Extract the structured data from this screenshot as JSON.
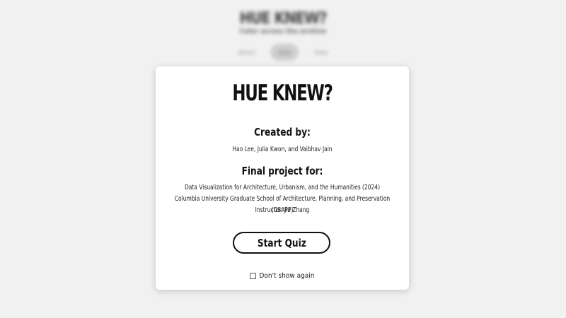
{
  "background": {
    "title": "HUE KNEW?",
    "subtitle": "Color across the archive",
    "nav": [
      "About",
      "Quiz",
      "Data"
    ]
  },
  "modal": {
    "title": "HUE KNEW?",
    "created_heading": "Created by:",
    "authors": "Hao Lee, Julia Kwon, and Vaibhav Jain",
    "project_heading": "Final project for:",
    "course_line1": "Data Visualization for Architecture, Urbanism, and the Humanities (2024)",
    "course_line2": "Columbia University Graduate School of Architecture, Planning, and Preservation (GSAPP)",
    "instructor": "Instructor: Jia Zhang",
    "start_button": "Start Quiz",
    "dont_show_label": "Don't show again"
  },
  "colors": {
    "background": "#efefef",
    "modal": "#ffffff",
    "text": "#111111"
  }
}
